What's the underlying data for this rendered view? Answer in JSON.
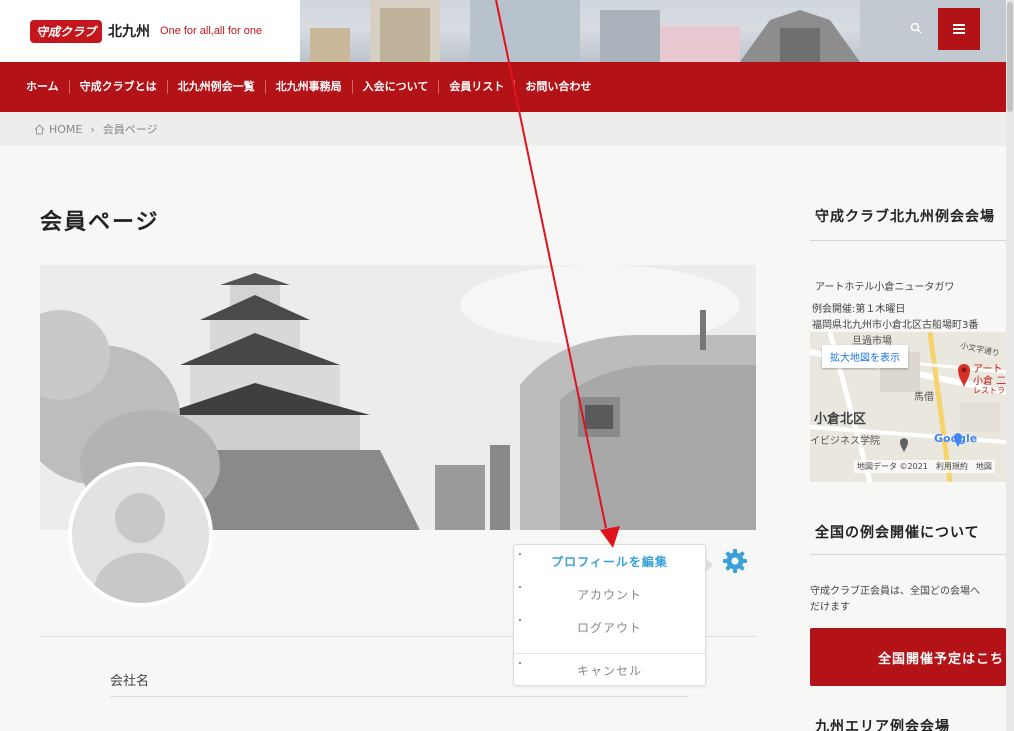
{
  "header": {
    "logo_mark": "守成クラブ",
    "logo_title": "北九州",
    "tagline": "One for all,all for one"
  },
  "nav": {
    "items": [
      "ホーム",
      "守成クラブとは",
      "北九州例会一覧",
      "北九州事務局",
      "入会について",
      "会員リスト",
      "お問い合わせ"
    ]
  },
  "breadcrumb": {
    "home": "HOME",
    "current": "会員ページ"
  },
  "main": {
    "title": "会員ページ",
    "field_label": "会社名"
  },
  "menu": {
    "items": [
      {
        "label": "プロフィールを編集",
        "active": true
      },
      {
        "label": "アカウント",
        "active": false
      },
      {
        "label": "ログアウト",
        "active": false
      },
      {
        "label": "キャンセル",
        "active": false
      }
    ]
  },
  "sidebar": {
    "venue_title": "守成クラブ北九州例会会場",
    "venue_name": "アートホテル小倉ニュータガワ",
    "venue_day": "例会開催:第１木曜日",
    "venue_address": "福岡県北九州市小倉北区古船場町3番",
    "map": {
      "expand_button": "拡大地図を表示",
      "label_market": "旦過市場",
      "label_street": "小文字通り",
      "label_district": "小倉北区",
      "label_place": "馬借",
      "label_school": "イビジネス学院",
      "label_pin_line1": "アート",
      "label_pin_line2": "小倉 二",
      "label_pin_line3": "レストラ",
      "label_google": "Google",
      "footer": "地図データ ©2021　利用規約　地図"
    },
    "national_title": "全国の例会開催について",
    "national_text_line1": "守成クラブ正会員は、全国どの会場へ",
    "national_text_line2": "だけます",
    "cta_label": "全国開催予定はこち",
    "kyushu_title": "九州エリア例会会場"
  },
  "colors": {
    "brand_red": "#b31217",
    "active_blue": "#3ba1da",
    "annotation_red": "#e0121b"
  }
}
